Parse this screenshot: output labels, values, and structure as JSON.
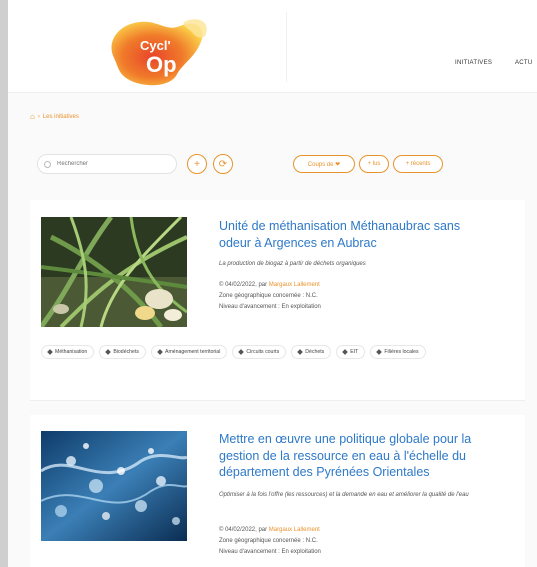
{
  "brand": {
    "logo_text_top": "Cycl'",
    "logo_text_bottom": "Op"
  },
  "nav": {
    "items": [
      "INITIATIVES",
      "ACTU"
    ]
  },
  "breadcrumb": {
    "home_icon": "home-icon",
    "separator": "›",
    "current": "Les initiatives"
  },
  "search": {
    "placeholder": "Rechercher",
    "add_label": "+",
    "reset_label": "⟳"
  },
  "filters": {
    "favorites_label": "Coups de ❤",
    "plus_vus_label": "+ lus",
    "plus_recents_label": "+ récents"
  },
  "colors": {
    "accent": "#e9932e",
    "link": "#2e79c7"
  },
  "cards": [
    {
      "title": "Unité de méthanisation Méthanaubrac sans odeur à Argences en Aubrac",
      "subtitle": "La production de biogaz à partir de déchets organiques",
      "date_prefix": "© 04/02/2022, par ",
      "author": "Margaux Lallement",
      "zone": "Zone géographique concernée : N.C.",
      "niveau": "Niveau d'avancement : En exploitation",
      "tags": [
        "Méthanisation",
        "Biodéchets",
        "Aménagement territorial",
        "Circuits courts",
        "Déchets",
        "EIT",
        "Filières locales"
      ]
    },
    {
      "title": "Mettre en œuvre une politique globale pour la gestion de la ressource en eau à l'échelle du département des Pyrénées Orientales",
      "subtitle": "Optimiser à la fois l'offre (les ressources) et la demande en eau et améliorer la qualité de l'eau",
      "date_prefix": "© 04/02/2022, par ",
      "author": "Margaux Lallement",
      "zone": "Zone géographique concernée : N.C.",
      "niveau": "Niveau d'avancement : En exploitation"
    }
  ]
}
